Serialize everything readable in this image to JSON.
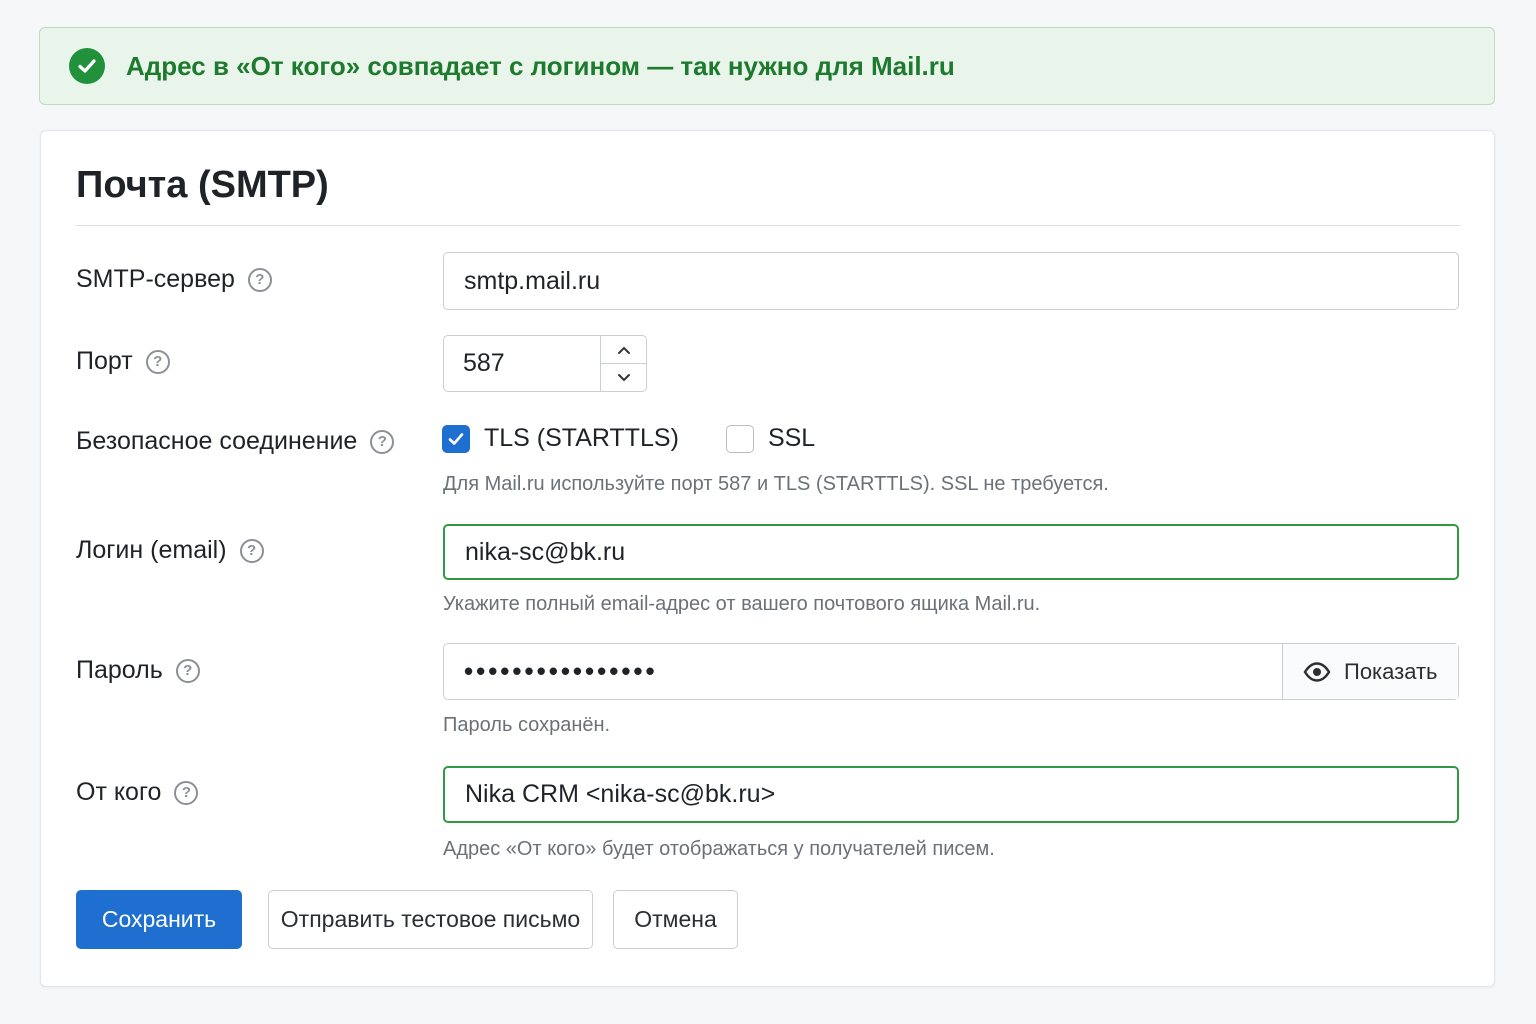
{
  "banner": {
    "icon": "check-circle-icon",
    "message": "Адрес в «От кого» совпадает с логином — так нужно для Mail.ru",
    "color": "#21913c"
  },
  "card": {
    "title": "Почта (SMTP)"
  },
  "fields": {
    "server": {
      "label": "SMTP-сервер",
      "value": "smtp.mail.ru"
    },
    "port": {
      "label": "Порт",
      "value": "587"
    },
    "secure": {
      "label": "Безопасное соединение",
      "tls_label": "TLS (STARTTLS)",
      "tls_checked": true,
      "ssl_label": "SSL",
      "ssl_checked": false,
      "hint": "Для Mail.ru используйте порт 587 и TLS (STARTTLS). SSL не требуется."
    },
    "login": {
      "label": "Логин (email)",
      "value": "nika-sc@bk.ru",
      "hint": "Укажите полный email-адрес от вашего почтового ящика Mail.ru."
    },
    "password": {
      "label": "Пароль",
      "value": "••••••••••••••••",
      "show_label": "Показать",
      "hint": "Пароль сохранён."
    },
    "from": {
      "label": "От кого",
      "value": "Nika CRM <nika-sc@bk.ru>",
      "hint": "Адрес «От кого» будет отображаться у получателей писем."
    }
  },
  "actions": {
    "save": "Сохранить",
    "test": "Отправить тестовое письмо",
    "cancel": "Отмена"
  },
  "colors": {
    "accent": "#1f6fd1",
    "success": "#2f9a3f",
    "banner_bg": "#e9f5ea"
  }
}
